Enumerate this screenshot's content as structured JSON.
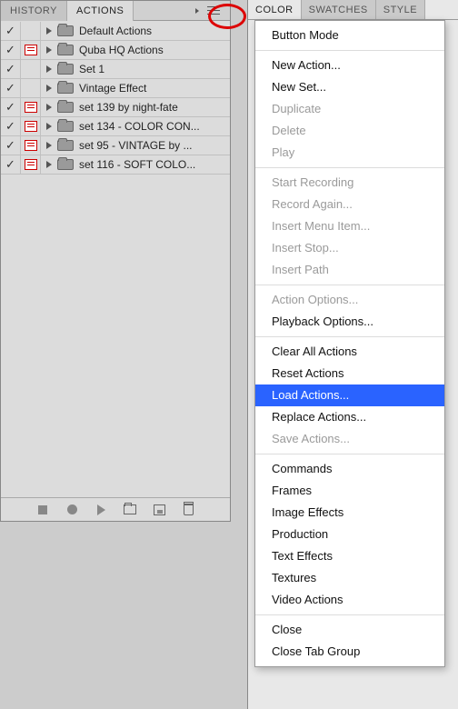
{
  "panel": {
    "tabs": [
      {
        "label": "HISTORY",
        "active": false
      },
      {
        "label": "ACTIONS",
        "active": true
      }
    ],
    "rows": [
      {
        "toggle": true,
        "dialog": false,
        "label": "Default Actions"
      },
      {
        "toggle": true,
        "dialog": true,
        "label": "Quba HQ Actions"
      },
      {
        "toggle": true,
        "dialog": false,
        "label": "Set 1"
      },
      {
        "toggle": true,
        "dialog": false,
        "label": "Vintage Effect"
      },
      {
        "toggle": true,
        "dialog": true,
        "label": "set 139 by night-fate"
      },
      {
        "toggle": true,
        "dialog": true,
        "label": "set 134 - COLOR CON..."
      },
      {
        "toggle": true,
        "dialog": true,
        "label": "set 95 - VINTAGE  by ..."
      },
      {
        "toggle": true,
        "dialog": true,
        "label": "set 116 - SOFT COLO..."
      }
    ]
  },
  "rightTabs": [
    {
      "label": "COLOR",
      "active": true
    },
    {
      "label": "SWATCHES",
      "active": false
    },
    {
      "label": "STYLE",
      "active": false
    }
  ],
  "menu": {
    "groups": [
      [
        {
          "label": "Button Mode",
          "state": "enabled"
        }
      ],
      [
        {
          "label": "New Action...",
          "state": "enabled"
        },
        {
          "label": "New Set...",
          "state": "enabled"
        },
        {
          "label": "Duplicate",
          "state": "disabled"
        },
        {
          "label": "Delete",
          "state": "disabled"
        },
        {
          "label": "Play",
          "state": "disabled"
        }
      ],
      [
        {
          "label": "Start Recording",
          "state": "disabled"
        },
        {
          "label": "Record Again...",
          "state": "disabled"
        },
        {
          "label": "Insert Menu Item...",
          "state": "disabled"
        },
        {
          "label": "Insert Stop...",
          "state": "disabled"
        },
        {
          "label": "Insert Path",
          "state": "disabled"
        }
      ],
      [
        {
          "label": "Action Options...",
          "state": "disabled"
        },
        {
          "label": "Playback Options...",
          "state": "enabled"
        }
      ],
      [
        {
          "label": "Clear All Actions",
          "state": "enabled"
        },
        {
          "label": "Reset Actions",
          "state": "enabled"
        },
        {
          "label": "Load Actions...",
          "state": "highlight"
        },
        {
          "label": "Replace Actions...",
          "state": "enabled"
        },
        {
          "label": "Save Actions...",
          "state": "disabled"
        }
      ],
      [
        {
          "label": "Commands",
          "state": "enabled"
        },
        {
          "label": "Frames",
          "state": "enabled"
        },
        {
          "label": "Image Effects",
          "state": "enabled"
        },
        {
          "label": "Production",
          "state": "enabled"
        },
        {
          "label": "Text Effects",
          "state": "enabled"
        },
        {
          "label": "Textures",
          "state": "enabled"
        },
        {
          "label": "Video Actions",
          "state": "enabled"
        }
      ],
      [
        {
          "label": "Close",
          "state": "enabled"
        },
        {
          "label": "Close Tab Group",
          "state": "enabled"
        }
      ]
    ]
  }
}
